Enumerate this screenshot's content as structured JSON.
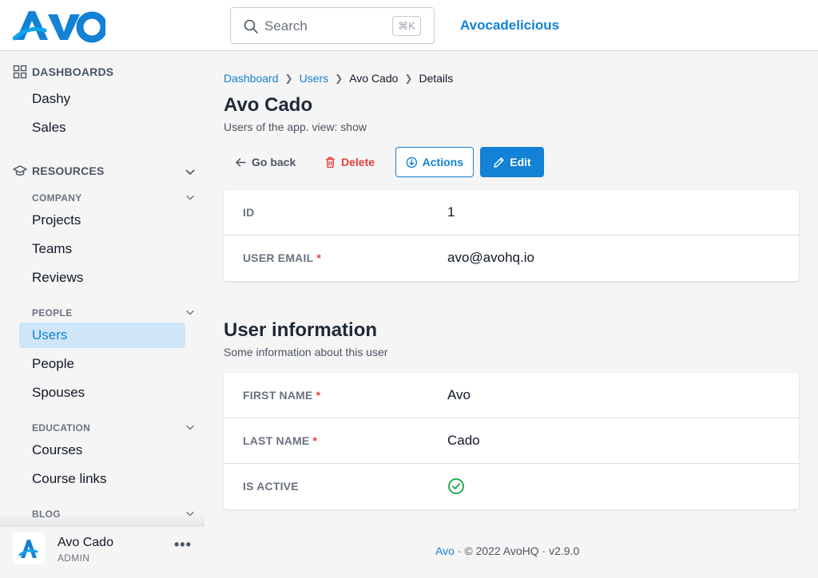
{
  "brand": {
    "logo_text": "Avo",
    "accent": "#1381d5"
  },
  "header": {
    "search_placeholder": "Search",
    "search_shortcut": "⌘K",
    "app_name": "Avocadelicious"
  },
  "sidebar": {
    "dashboards": {
      "heading": "DASHBOARDS",
      "items": [
        {
          "label": "Dashy"
        },
        {
          "label": "Sales"
        }
      ]
    },
    "resources": {
      "heading": "RESOURCES",
      "groups": [
        {
          "heading": "COMPANY",
          "items": [
            {
              "label": "Projects"
            },
            {
              "label": "Teams"
            },
            {
              "label": "Reviews"
            }
          ]
        },
        {
          "heading": "PEOPLE",
          "items": [
            {
              "label": "Users",
              "active": true
            },
            {
              "label": "People"
            },
            {
              "label": "Spouses"
            }
          ]
        },
        {
          "heading": "EDUCATION",
          "items": [
            {
              "label": "Courses"
            },
            {
              "label": "Course links"
            }
          ]
        },
        {
          "heading": "BLOG",
          "items": []
        }
      ]
    },
    "user": {
      "name": "Avo Cado",
      "role": "ADMIN",
      "menu": "•••"
    }
  },
  "breadcrumb": [
    {
      "label": "Dashboard",
      "link": true
    },
    {
      "label": "Users",
      "link": true
    },
    {
      "label": "Avo Cado",
      "link": false
    },
    {
      "label": "Details",
      "link": false
    }
  ],
  "page": {
    "title": "Avo Cado",
    "subtitle": "Users of the app. view: show"
  },
  "toolbar": {
    "back_label": "Go back",
    "delete_label": "Delete",
    "actions_label": "Actions",
    "edit_label": "Edit"
  },
  "main_fields": [
    {
      "label": "ID",
      "required": false,
      "value": "1"
    },
    {
      "label": "USER EMAIL",
      "required": true,
      "value": "avo@avohq.io"
    }
  ],
  "user_information": {
    "title": "User information",
    "description": "Some information about this user",
    "fields": [
      {
        "label": "FIRST NAME",
        "required": true,
        "value": "Avo"
      },
      {
        "label": "LAST NAME",
        "required": true,
        "value": "Cado"
      },
      {
        "label": "IS ACTIVE",
        "required": false,
        "value_icon": "check-circle-icon",
        "value_color": "#16a34a"
      }
    ]
  },
  "footer": {
    "brand": "Avo",
    "text": " · © 2022 AvoHQ · v2.9.0"
  },
  "required_marker": "*"
}
